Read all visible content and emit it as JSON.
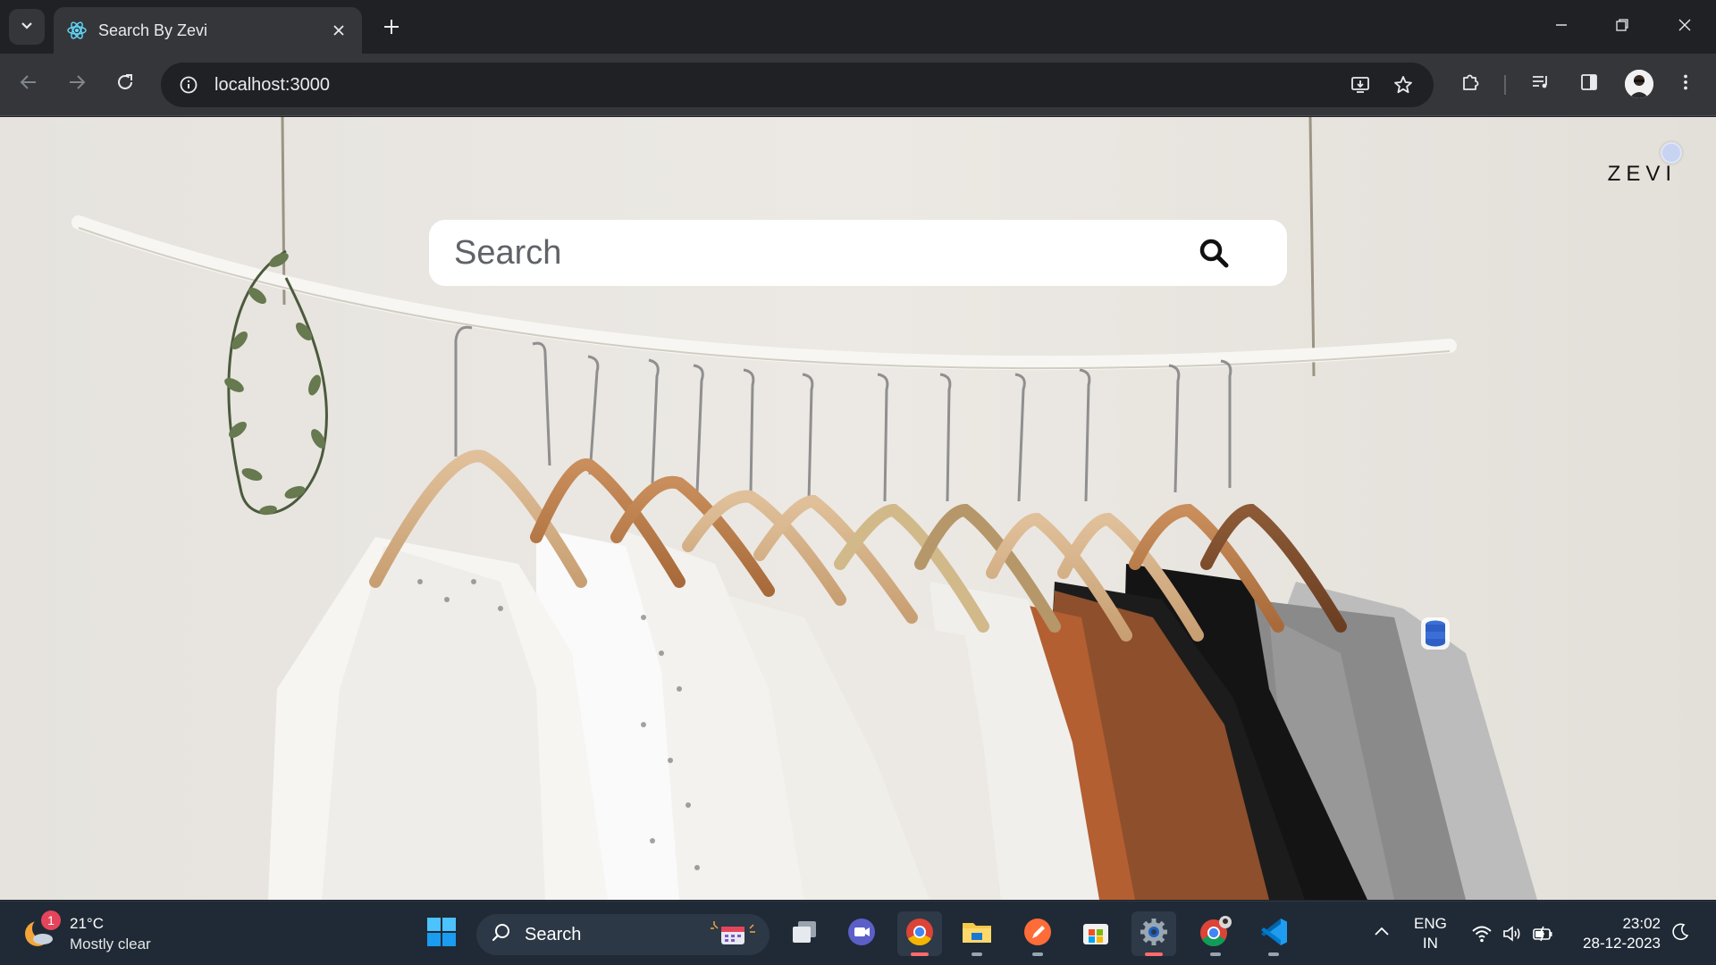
{
  "browser": {
    "tab": {
      "title": "Search By Zevi",
      "favicon": "react-icon"
    },
    "address": {
      "url": "localhost:3000"
    },
    "accent": "#35363a"
  },
  "page": {
    "logo": "ZEVI",
    "search": {
      "placeholder": "Search",
      "value": ""
    },
    "background": "clothing-rack-photo"
  },
  "taskbar": {
    "weather": {
      "temp": "21°C",
      "desc": "Mostly clear",
      "badge": "1"
    },
    "search_label": "Search",
    "lang_line1": "ENG",
    "lang_line2": "IN",
    "time": "23:02",
    "date": "28-12-2023",
    "apps": [
      "start-icon",
      "task-view-icon",
      "video-chat-icon",
      "chrome-icon",
      "file-explorer-icon",
      "pen-app-icon",
      "store-icon",
      "settings-icon",
      "chrome-profile-icon",
      "vscode-icon"
    ]
  }
}
